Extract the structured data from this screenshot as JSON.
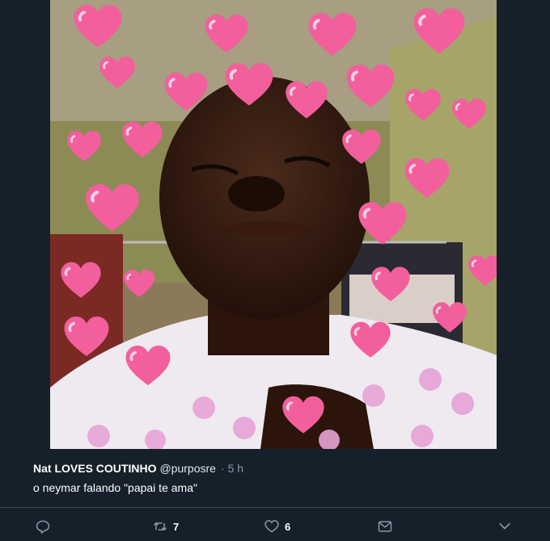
{
  "tweet": {
    "author_name": "Nat LOVES COUTINHO",
    "handle": "@purposre",
    "separator": "·",
    "timestamp": "5 h",
    "text": "o neymar falando \"papai te ama\"",
    "media": {
      "icon": "photo",
      "description_icons": [
        "heart-emoji",
        "flower-pattern"
      ]
    }
  },
  "actions": {
    "reply": {
      "icon": "reply-icon",
      "count": ""
    },
    "retweet": {
      "icon": "retweet-icon",
      "count": "7"
    },
    "like": {
      "icon": "heart-icon",
      "count": "6"
    },
    "message": {
      "icon": "envelope-icon",
      "count": ""
    },
    "more": {
      "icon": "chevron-down-icon",
      "count": ""
    }
  },
  "colors": {
    "background": "#15202b",
    "secondary_text": "#8899a6",
    "divider": "#38444d",
    "heart_emoji": "#f25f9c"
  }
}
